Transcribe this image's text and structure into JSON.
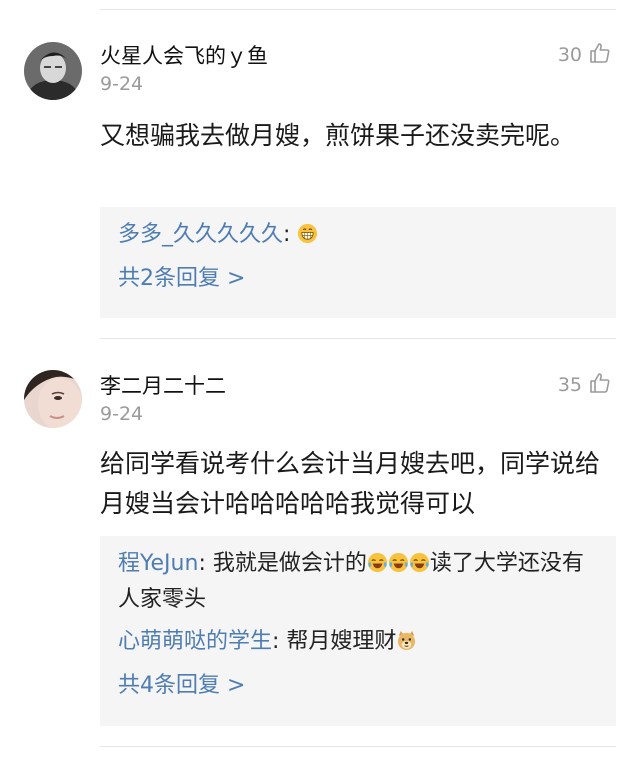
{
  "comments": [
    {
      "username": "火星人会飞的ｙ鱼",
      "date": "9-24",
      "likes": "30",
      "text": "又想骗我去做月嫂，煎饼果子还没卖完呢。",
      "replies": [
        {
          "user": "多多_久久久久久",
          "sep": ": ",
          "text": "",
          "emoji": [
            "grin"
          ]
        }
      ],
      "more_label": "共2条回复 >"
    },
    {
      "username": "李二月二十二",
      "date": "9-24",
      "likes": "35",
      "text": "给同学看说考什么会计当月嫂去吧，同学说给月嫂当会计哈哈哈哈哈我觉得可以",
      "replies": [
        {
          "user": "程YeJun",
          "sep": ": ",
          "text_before": "我就是做会计的",
          "emoji": [
            "laugh-cry",
            "laugh-cry",
            "laugh-cry"
          ],
          "text_after": "读了大学还没有人家零头"
        },
        {
          "user": "心萌萌哒的学生",
          "sep": ": ",
          "text_before": "帮月嫂理财",
          "emoji": [
            "doge"
          ]
        }
      ],
      "more_label": "共4条回复 >"
    }
  ],
  "colors": {
    "link": "#4f7db3",
    "meta": "#9a9a9a",
    "reply_bg": "#f5f5f5",
    "divider": "#e6e6e6"
  },
  "icons": {
    "like": "thumbs-up-outline-icon",
    "emoji_grin": "grinning-face-icon",
    "emoji_laugh_cry": "tears-of-joy-face-icon",
    "emoji_doge": "doge-face-icon"
  }
}
